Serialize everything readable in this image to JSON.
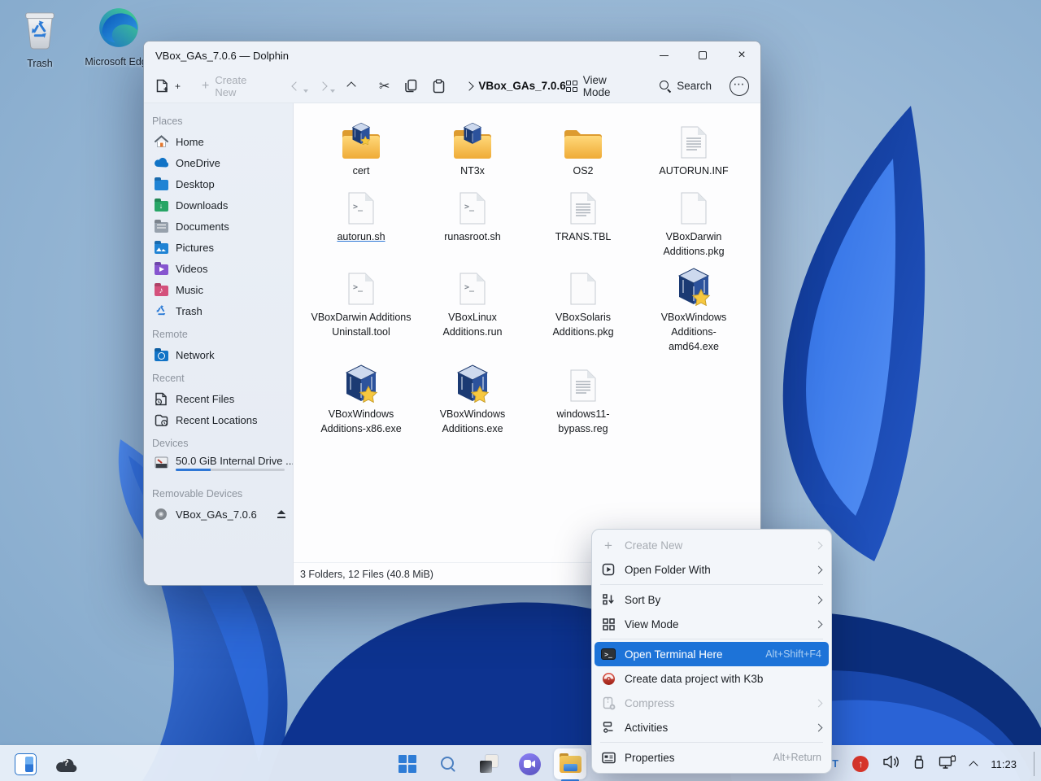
{
  "desktop": {
    "trash_label": "Trash",
    "edge_label": "Microsoft Edge"
  },
  "window": {
    "title": "VBox_GAs_7.0.6 — Dolphin",
    "toolbar": {
      "create_new": "Create New",
      "breadcrumb": "VBox_GAs_7.0.6",
      "view_mode": "View Mode",
      "search": "Search"
    },
    "sidebar": {
      "sections": [
        {
          "title": "Places",
          "items": [
            "Home",
            "OneDrive",
            "Desktop",
            "Downloads",
            "Documents",
            "Pictures",
            "Videos",
            "Music",
            "Trash"
          ]
        },
        {
          "title": "Remote",
          "items": [
            "Network"
          ]
        },
        {
          "title": "Recent",
          "items": [
            "Recent Files",
            "Recent Locations"
          ]
        },
        {
          "title": "Devices",
          "items": [
            "50.0 GiB Internal Drive ..."
          ]
        },
        {
          "title": "Removable Devices",
          "items": [
            "VBox_GAs_7.0.6"
          ]
        }
      ]
    },
    "files": [
      {
        "name": "cert"
      },
      {
        "name": "NT3x"
      },
      {
        "name": "OS2"
      },
      {
        "name": "AUTORUN.INF"
      },
      {
        "name": "autorun.sh"
      },
      {
        "name": "runasroot.sh"
      },
      {
        "name": "TRANS.TBL"
      },
      {
        "name": "VBoxDarwin Additions.pkg"
      },
      {
        "name": "VBoxDarwin Additions Uninstall.tool"
      },
      {
        "name": "VBoxLinux Additions.run"
      },
      {
        "name": "VBoxSolaris Additions.pkg"
      },
      {
        "name": "VBoxWindows Additions-amd64.exe"
      },
      {
        "name": "VBoxWindows Additions-x86.exe"
      },
      {
        "name": "VBoxWindows Additions.exe"
      },
      {
        "name": "windows11-bypass.reg"
      }
    ],
    "status": "3 Folders, 12 Files (40.8 MiB)"
  },
  "context_menu": {
    "items": [
      {
        "label": "Create New"
      },
      {
        "label": "Open Folder With"
      },
      {
        "label": "Sort By"
      },
      {
        "label": "View Mode"
      },
      {
        "label": "Open Terminal Here",
        "shortcut": "Alt+Shift+F4"
      },
      {
        "label": "Create data project with K3b"
      },
      {
        "label": "Compress"
      },
      {
        "label": "Activities"
      },
      {
        "label": "Properties",
        "shortcut": "Alt+Return"
      }
    ]
  },
  "taskbar": {
    "keyboard_layout": "PT",
    "time": "11:23"
  },
  "icons": {
    "scissors": "✂",
    "more": "⋯",
    "up_arrow": "↑",
    "question": "?",
    "terminal_glyph": ">_",
    "script_glyph": ">_",
    "plus": "+"
  },
  "colors": {
    "accent": "#1d73d8"
  }
}
